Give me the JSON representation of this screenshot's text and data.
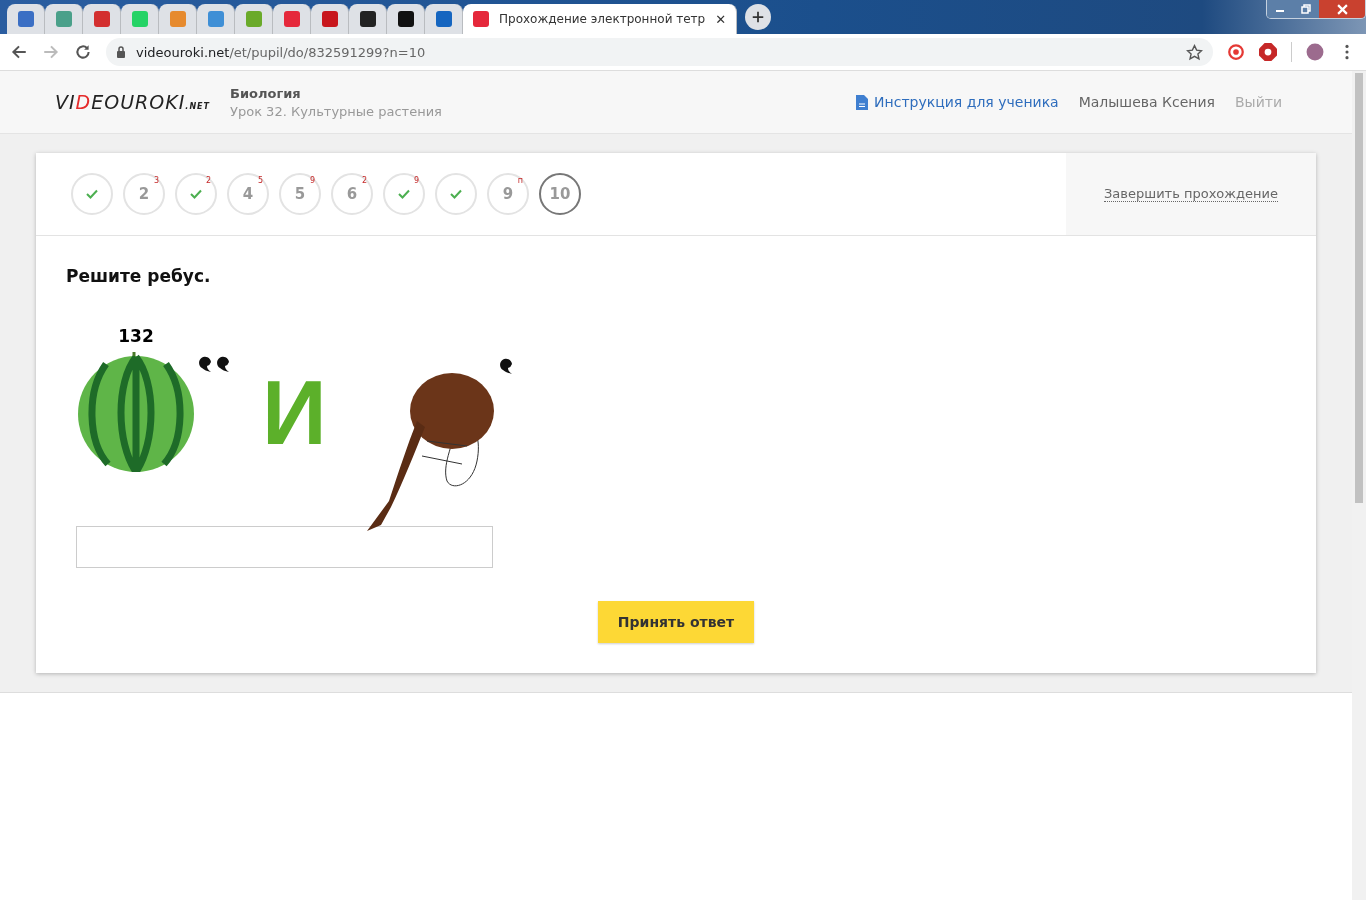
{
  "browser": {
    "tabs": [
      {
        "kind": "favicon",
        "selected": false,
        "color": "#3b6fc4"
      },
      {
        "kind": "favicon",
        "selected": false,
        "color": "#4aa08a"
      },
      {
        "kind": "favicon",
        "selected": false,
        "color": "#d32f2f"
      },
      {
        "kind": "favicon",
        "selected": false,
        "color": "#25d366"
      },
      {
        "kind": "favicon",
        "selected": false,
        "color": "#e68a2e"
      },
      {
        "kind": "favicon",
        "selected": false,
        "color": "#3f8fd6"
      },
      {
        "kind": "favicon",
        "selected": false,
        "color": "#6aaa2a"
      },
      {
        "kind": "favicon",
        "selected": false,
        "color": "#e5283b"
      },
      {
        "kind": "favicon",
        "selected": false,
        "color": "#c8161d"
      },
      {
        "kind": "favicon",
        "selected": false,
        "color": "#222222"
      },
      {
        "kind": "favicon",
        "selected": false,
        "color": "#111111"
      },
      {
        "kind": "favicon",
        "selected": false,
        "color": "#1565c0"
      },
      {
        "kind": "titled",
        "selected": true,
        "color": "#e5283b",
        "title": "Прохождение электронной тетр",
        "close": "✕"
      }
    ],
    "address": {
      "host": "videouroki.net",
      "path": "/et/pupil/do/832591299?n=10"
    }
  },
  "header": {
    "logo_left": "VI",
    "logo_mid": "DEOUROKI",
    "logo_suffix": ".NET",
    "subject": "Биология",
    "lesson": "Урок 32. Культурные растения",
    "instruction_link": "Инструкция для ученика",
    "user": "Малышева Ксения",
    "logout": "Выйти"
  },
  "questions": [
    {
      "kind": "done",
      "selected": false
    },
    {
      "kind": "number",
      "label": "2",
      "badge": "3",
      "selected": false
    },
    {
      "kind": "done",
      "badge": "2",
      "selected": false
    },
    {
      "kind": "number",
      "label": "4",
      "badge": "5",
      "selected": false
    },
    {
      "kind": "number",
      "label": "5",
      "badge": "9",
      "selected": false
    },
    {
      "kind": "number",
      "label": "6",
      "badge": "2",
      "selected": false
    },
    {
      "kind": "done",
      "badge": "9",
      "selected": false
    },
    {
      "kind": "done",
      "selected": false
    },
    {
      "kind": "number",
      "label": "9",
      "badge": "п",
      "selected": false
    },
    {
      "kind": "number",
      "label": "10",
      "selected": true
    }
  ],
  "finish_link": "Завершить прохождение",
  "task": {
    "prompt": "Решите ребус.",
    "rebus": {
      "number": "132",
      "letter": "И"
    },
    "submit": "Принять ответ"
  }
}
